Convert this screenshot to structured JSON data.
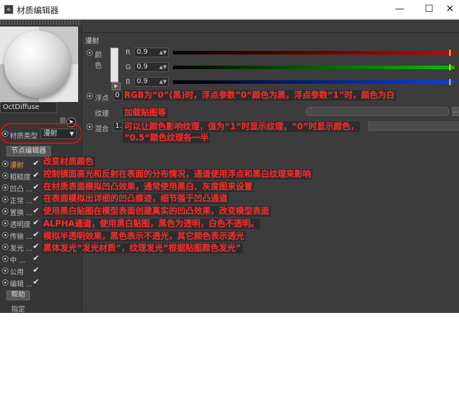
{
  "window": {
    "title": "材质编辑器",
    "minimize": "—",
    "maximize": "☐",
    "close": "✕"
  },
  "left": {
    "material_name": "OctDiffuse",
    "material_type_label": "材质类型",
    "material_type_value": "漫射",
    "node_editor_button": "节点编辑器",
    "channels": [
      {
        "label": "漫射",
        "checked": "✔"
      },
      {
        "label": "粗糙度",
        "checked": "✔"
      },
      {
        "label": "凹凸 ...",
        "checked": "✔"
      },
      {
        "label": "正常 ...",
        "checked": "✔"
      },
      {
        "label": "置换 ...",
        "checked": "✔"
      },
      {
        "label": "透明度",
        "checked": "✔"
      },
      {
        "label": "传输 ...",
        "checked": "✔"
      },
      {
        "label": "发光 ...",
        "checked": "✔"
      },
      {
        "label": "中 ...",
        "checked": "✔"
      },
      {
        "label": "公用",
        "checked": "✔"
      },
      {
        "label": "编辑 ...",
        "checked": "✔"
      }
    ],
    "help_button": "帮助",
    "assign_label": "指定"
  },
  "right": {
    "section_title": "漫射",
    "color_label": "颜色",
    "rgb": [
      {
        "channel": "R",
        "value": "0.9"
      },
      {
        "channel": "G",
        "value": "0.9"
      },
      {
        "channel": "B",
        "value": "0.9"
      }
    ],
    "float_label": "浮点",
    "float_value": "0",
    "texture_label": "纹理",
    "mix_label": "混合",
    "mix_value": "1."
  },
  "annotations": {
    "rgb_note": "RGB为“0”(黑)时，浮点参数”0“颜色为黑，浮点参数“1”时，颜色为白",
    "texture_note": "加载贴图等",
    "mix_note_1": "可以让颜色影响纹理，值为“1”时显示纹理，“0”时显示颜色，",
    "mix_note_2": "”0.5“颜色纹理各一半",
    "diffuse_note": "改变材质颜色",
    "roughness_note": "控制镜面高光和反射在表面的分布情况，通道使用浮点和黑白纹理来影响",
    "bump_note": "在材质表面模拟凹凸效果，通常使用黑白、灰度图来设置",
    "normal_note": "在表面模拟出详细的凹凸痕迹，细节强于凹凸通道",
    "displacement_note": "使用黑白贴图在模型表面创建真实的凹凸效果，改变模型表面",
    "opacity_note": "ALPHA通道，使用黑白贴图，黑色为透明，白色不透明。",
    "transmission_note": "模拟半透明效果，黑色表示不透光，其它颜色表示透光",
    "emission_note": "黑体发光“发光材质”，纹理发光“根据贴图颜色发光”"
  },
  "colors": {
    "annotation_red": "#ff2a2a",
    "active_channel": "#f0a030",
    "panel_bg": "#3a3a3a"
  }
}
